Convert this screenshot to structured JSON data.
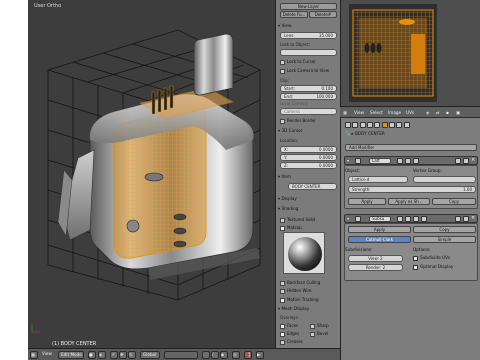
{
  "viewport": {
    "label": "User Ortho",
    "status": "(1) BODY CENTER"
  },
  "npanel": {
    "new_layer": "New Layer",
    "btn_a": "Delete Fo...",
    "btn_b": "Delete#",
    "view_head": "View",
    "lens_label": "Lens:",
    "lens_value": "35.000",
    "lock_to_object": "Lock to Object:",
    "lock_cursor": "Lock to Cursor",
    "lock_camera": "Lock Camera to View",
    "clip": "Clip:",
    "start_label": "Start:",
    "start_value": "0.100",
    "end_label": "End:",
    "end_value": "100.000",
    "local_camera": "Local Camera:",
    "camera": "Camera",
    "render_border": "Render Border",
    "cursor_head": "3D Cursor",
    "location": "Location:",
    "x_label": "X:",
    "x_value": "0.0000",
    "y_label": "Y:",
    "y_value": "0.0000",
    "z_label": "Z:",
    "z_value": "0.0000",
    "item_head": "Item",
    "item_name": "BODY CENTER",
    "display_head": "Display",
    "shading_head": "Shading",
    "textured_solid": "Textured Solid",
    "matcap": "Matcap",
    "backface_culling": "Backface Culling",
    "hidden_wire": "Hidden Wire",
    "motion_tracking": "Motion Tracking",
    "mesh_display": "Mesh Display",
    "overlays": "Overlays:",
    "faces": "Faces",
    "edges": "Edges",
    "creases": "Creases",
    "sharp": "Sharp",
    "bevel": "Bevel"
  },
  "bottombar": {
    "view": "View",
    "mode": "Edit Mode",
    "pivot": "Global"
  },
  "propheader": {
    "view": "View",
    "select": "Select",
    "image": "Image",
    "uvs": "UVs"
  },
  "props": {
    "object_name": "BODY CENTER",
    "add_modifier": "Add Modifier",
    "lattice_name": "Latt",
    "object_label": "Object:",
    "lattice_object": "Lattice.d",
    "vertex_group": "Vertex Group:",
    "strength_label": "Strength:",
    "strength_value": "1.00",
    "apply": "Apply",
    "apply_as_shape": "Apply as Sh...",
    "copy": "Copy",
    "subsurf_name": "Subsu",
    "apply2": "Apply",
    "copy2": "Copy",
    "catmull": "Catmull-Clark",
    "simple": "Simple",
    "subdivisions": "Subdivisions:",
    "view_label": "View:",
    "view_levels": "2",
    "render_label": "Render:",
    "render_levels": "2",
    "options": "Options:",
    "subdivide_uvs": "Subdivide UVs",
    "optimal_display": "Optimal Display"
  },
  "colors": {
    "accent_orange": "#e8900a",
    "viewport_bg": "#3d3d3d",
    "panel_bg": "#7d7d7d"
  }
}
